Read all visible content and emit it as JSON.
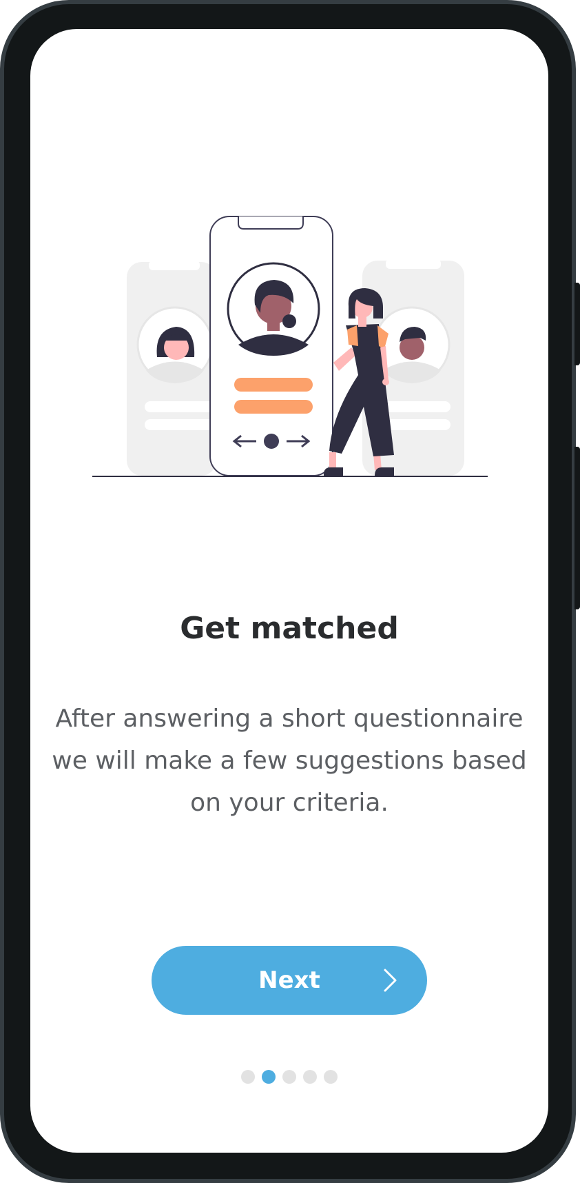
{
  "onboarding": {
    "title": "Get matched",
    "description": "After answering a short questionnaire we will make a few suggestions based on your criteria.",
    "next_label": "Next",
    "next_icon": "chevron-right-icon",
    "illustration": "phone-profile-matching-illustration",
    "pagination": {
      "total": 5,
      "active_index": 1
    }
  },
  "colors": {
    "accent": "#4eade0",
    "highlight_bars": "#fca16b",
    "dark_figure": "#2f2e41",
    "inactive_dot": "#e2e2e2",
    "ghost_card": "#f0f0f0"
  }
}
